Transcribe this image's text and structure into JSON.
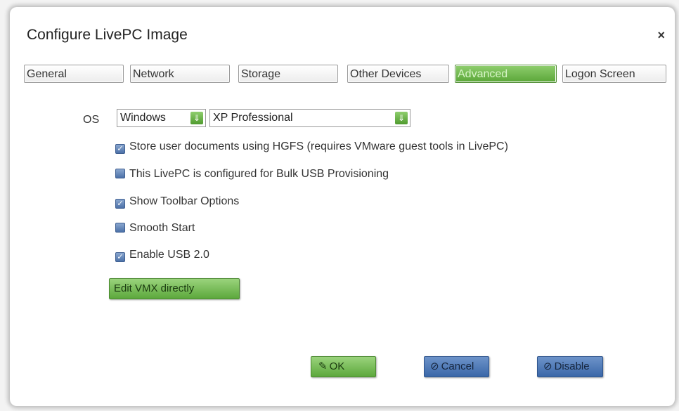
{
  "dialog": {
    "title": "Configure LivePC Image",
    "close_label": "×"
  },
  "tabs": [
    {
      "label": "General",
      "active": false
    },
    {
      "label": "Network",
      "active": false
    },
    {
      "label": "Storage",
      "active": false
    },
    {
      "label": "Other Devices",
      "active": false
    },
    {
      "label": "Advanced",
      "active": true
    },
    {
      "label": "Logon Screen",
      "active": false
    }
  ],
  "os": {
    "label": "OS",
    "family_value": "Windows",
    "version_value": "XP Professional"
  },
  "options": [
    {
      "label": "Store user documents using HGFS (requires VMware guest tools in LivePC)",
      "checked": true
    },
    {
      "label": "This LivePC is configured for Bulk USB Provisioning",
      "checked": false
    },
    {
      "label": "Show Toolbar Options",
      "checked": true
    },
    {
      "label": "Smooth Start",
      "checked": false
    },
    {
      "label": "Enable USB 2.0",
      "checked": true
    }
  ],
  "edit_vmx_label": "Edit VMX directly",
  "footer": {
    "ok_label": "OK",
    "cancel_label": "Cancel",
    "disable_label": "Disable"
  },
  "icons": {
    "ok": "pencil-icon",
    "cancel": "prohibit-icon",
    "disable": "prohibit-icon",
    "dropdown": "double-chevron-down-icon",
    "checkbox_checked": "checkmark-icon"
  },
  "colors": {
    "accent_green": "#5ca83c",
    "accent_blue": "#3a67a8"
  }
}
